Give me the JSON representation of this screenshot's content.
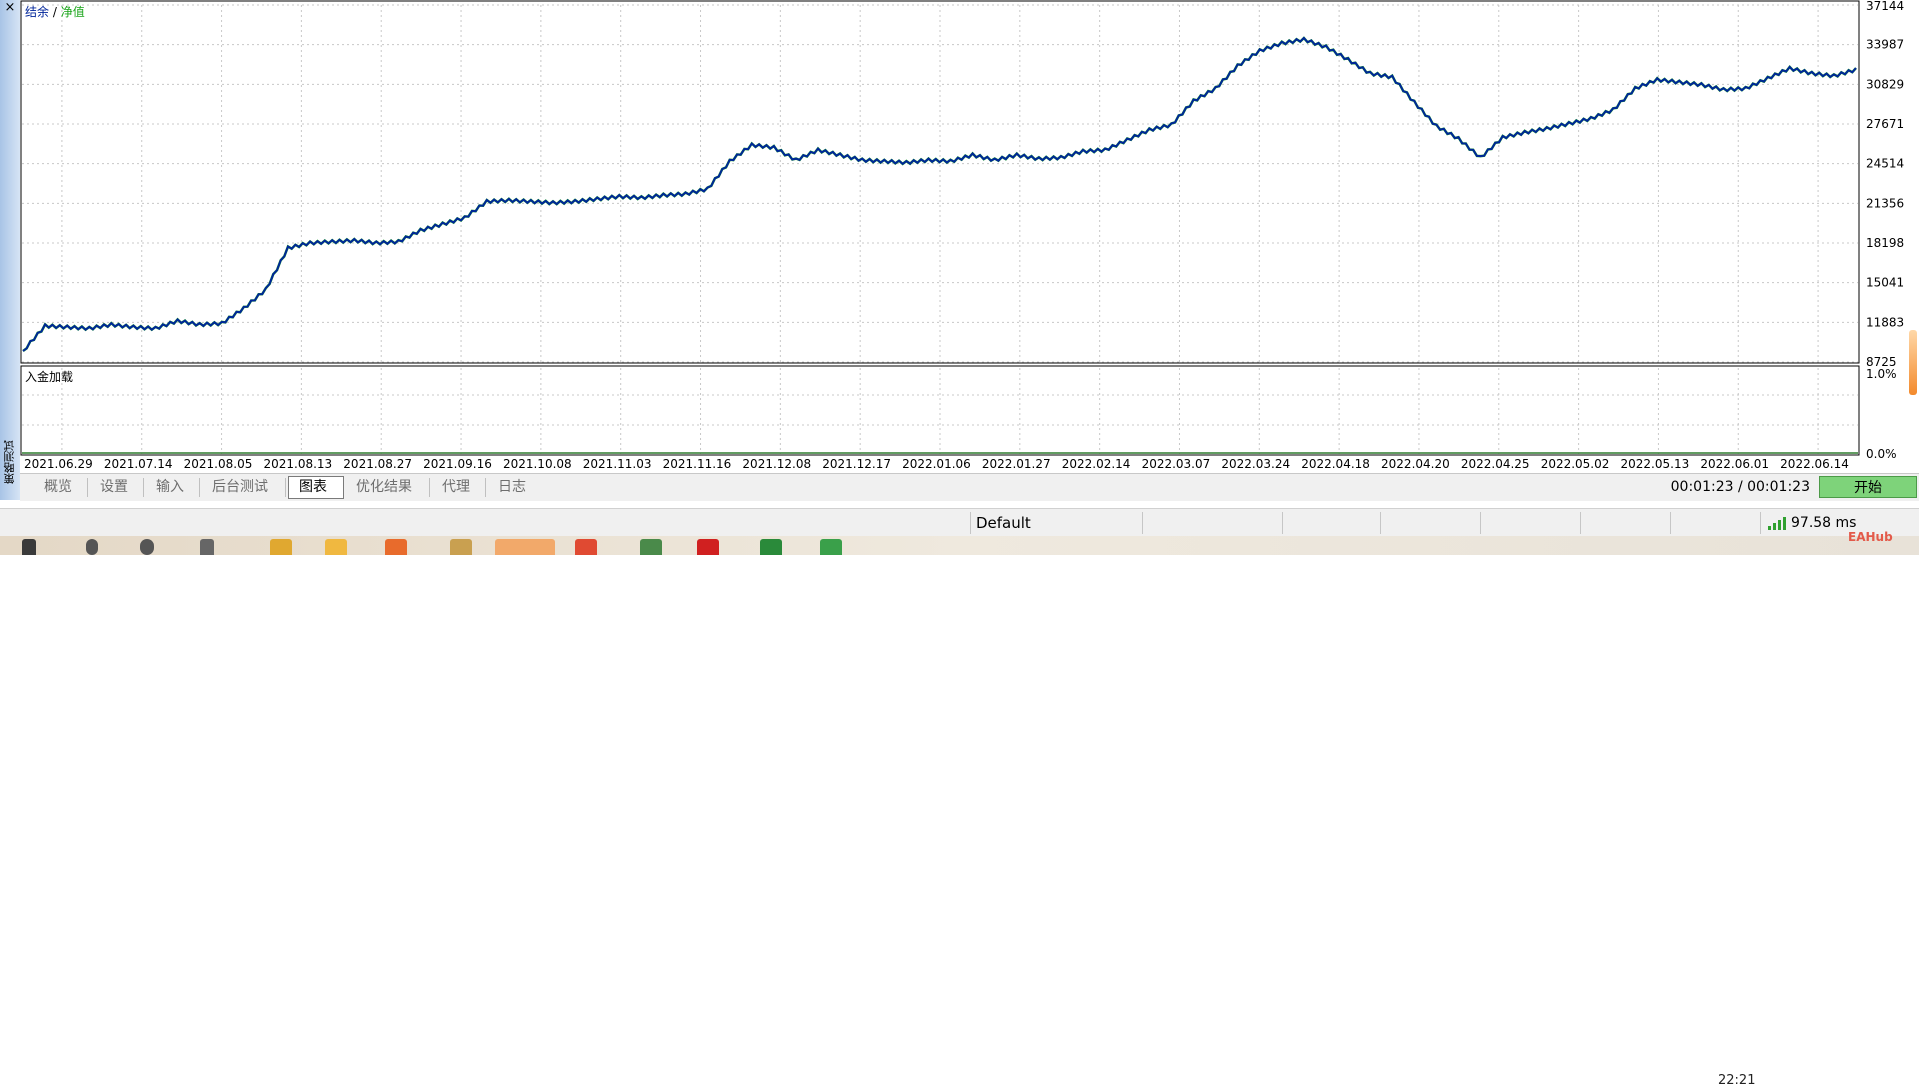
{
  "window": {
    "side_close": "×",
    "side_label": "策略测试"
  },
  "chart_data": {
    "type": "line",
    "legend": {
      "balance_label": "结余",
      "separator": " / ",
      "equity_label": "净值",
      "position": "top-left"
    },
    "colors": {
      "balance": "#00259a",
      "equity": "#16a316",
      "grid": "#c8c8c8",
      "deposit_line": "#2e7d2e"
    },
    "y_ticks": [
      "37144",
      "33987",
      "30829",
      "27671",
      "24514",
      "21356",
      "18198",
      "15041",
      "11883",
      "8725"
    ],
    "ylim": [
      8725,
      37144
    ],
    "x_ticks": [
      "2021.06.29",
      "2021.07.14",
      "2021.08.05",
      "2021.08.13",
      "2021.08.27",
      "2021.09.16",
      "2021.10.08",
      "2021.11.03",
      "2021.11.16",
      "2021.12.08",
      "2021.12.17",
      "2022.01.06",
      "2022.01.27",
      "2022.02.14",
      "2022.03.07",
      "2022.03.24",
      "2022.04.18",
      "2022.04.20",
      "2022.04.25",
      "2022.05.02",
      "2022.05.13",
      "2022.06.01",
      "2022.06.14"
    ],
    "grid": true,
    "series": [
      {
        "name": "结余",
        "values": [
          9600,
          11600,
          11500,
          11400,
          11700,
          11500,
          11400,
          12000,
          11700,
          11800,
          13000,
          14500,
          17800,
          18200,
          18300,
          18400,
          18200,
          18300,
          19200,
          19700,
          20200,
          21500,
          21600,
          21500,
          21400,
          21500,
          21700,
          21900,
          21800,
          22000,
          22100,
          22500,
          24700,
          26000,
          25800,
          24800,
          25600,
          25200,
          24800,
          24700,
          24600,
          24800,
          24700,
          25200,
          24800,
          25200,
          24900,
          25000,
          25500,
          25600,
          26400,
          27200,
          27600,
          29500,
          30500,
          32300,
          33500,
          34100,
          34400,
          33800,
          32800,
          31700,
          31400,
          29400,
          27500,
          26500,
          25000,
          26600,
          27000,
          27300,
          27700,
          28100,
          28800,
          30500,
          31200,
          31000,
          30800,
          30400,
          30500,
          31300,
          32100,
          31700,
          31500,
          32000
        ]
      }
    ],
    "sub_panel": {
      "label": "入金加载",
      "y_ticks": [
        "1.0%",
        "0.0%"
      ]
    }
  },
  "tabs": [
    {
      "label": "概览",
      "active": false
    },
    {
      "label": "设置",
      "active": false
    },
    {
      "label": "输入",
      "active": false
    },
    {
      "label": "后台测试",
      "active": false
    },
    {
      "label": "图表",
      "active": true
    },
    {
      "label": "优化结果",
      "active": false
    },
    {
      "label": "代理",
      "active": false
    },
    {
      "label": "日志",
      "active": false
    }
  ],
  "timer": "00:01:23 / 00:01:23",
  "start_button": "开始",
  "status_bar": {
    "profile": "Default",
    "ping": "97.58 ms"
  },
  "taskbar": {
    "clock": "22:21",
    "watermark": "EAHub"
  }
}
